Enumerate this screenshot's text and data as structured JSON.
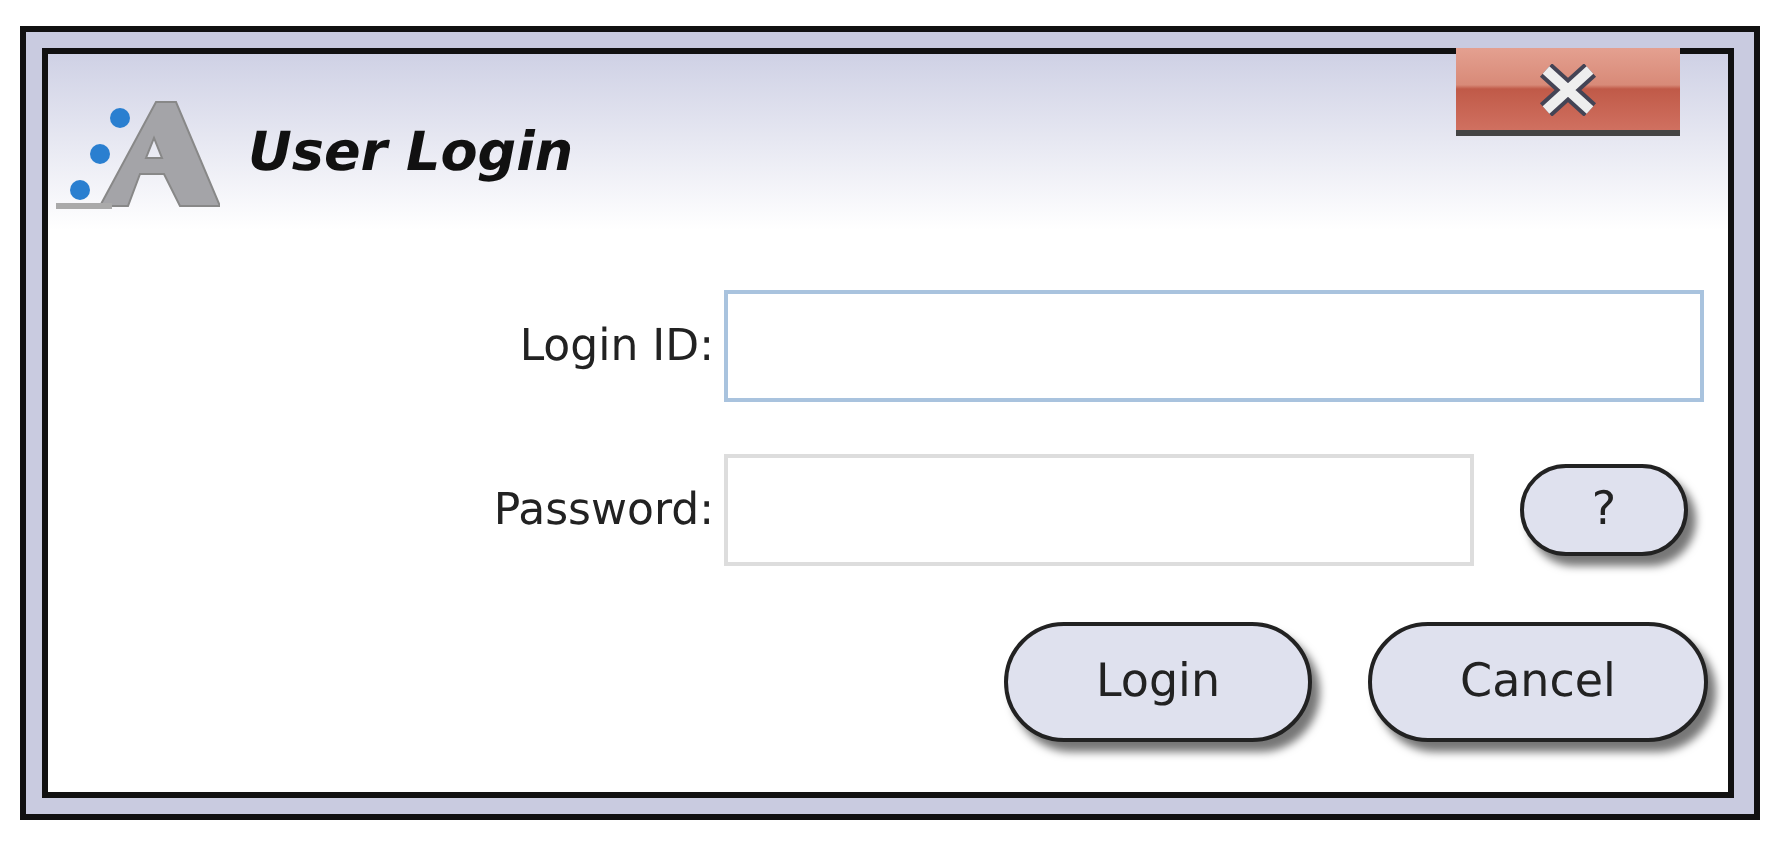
{
  "window": {
    "title": "User Login"
  },
  "fields": [
    {
      "label": "Login ID:",
      "focused": true
    },
    {
      "label": "Password:",
      "focused": false
    }
  ],
  "help_button": {
    "label": "?"
  },
  "buttons": [
    "Login",
    "Cancel"
  ]
}
